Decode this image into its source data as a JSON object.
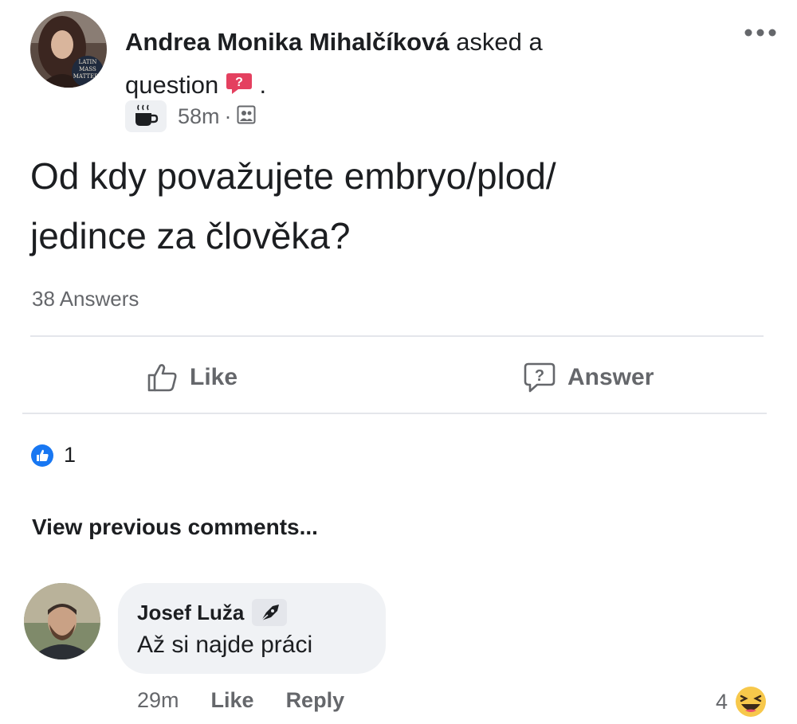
{
  "post": {
    "author_name": "Andrea Monika Mihalčíková",
    "action_text": "asked a",
    "action_text_2": "question",
    "period": ".",
    "time": "58m",
    "dot": "·",
    "avatar_text": [
      "LATIN",
      "MASS",
      "MATTERS"
    ],
    "question_line1": "Od kdy považujete embryo/plod/",
    "question_line2": "jedince za člověka?",
    "answers_count": "38 Answers",
    "reaction_count": "1"
  },
  "actions": {
    "like_label": "Like",
    "answer_label": "Answer"
  },
  "comments": {
    "view_previous": "View previous comments...",
    "items": [
      {
        "author": "Josef Luža",
        "text": "Až si najde práci",
        "time": "29m",
        "like_label": "Like",
        "reply_label": "Reply",
        "reaction_count": "4"
      }
    ]
  },
  "colors": {
    "accent_blue": "#1877f2",
    "badge_red": "#e4405f",
    "text_secondary": "#65676b",
    "bubble_bg": "#f0f2f5"
  },
  "icons": {
    "question_badge": "question-badge-icon",
    "coffee": "coffee-icon",
    "privacy": "group-privacy-icon",
    "more": "more-options-icon",
    "like": "thumbs-up-icon",
    "answer": "question-bubble-icon",
    "reaction_like": "like-reaction-icon",
    "top_fan": "quill-pen-icon",
    "reaction_haha": "haha-reaction-icon"
  }
}
